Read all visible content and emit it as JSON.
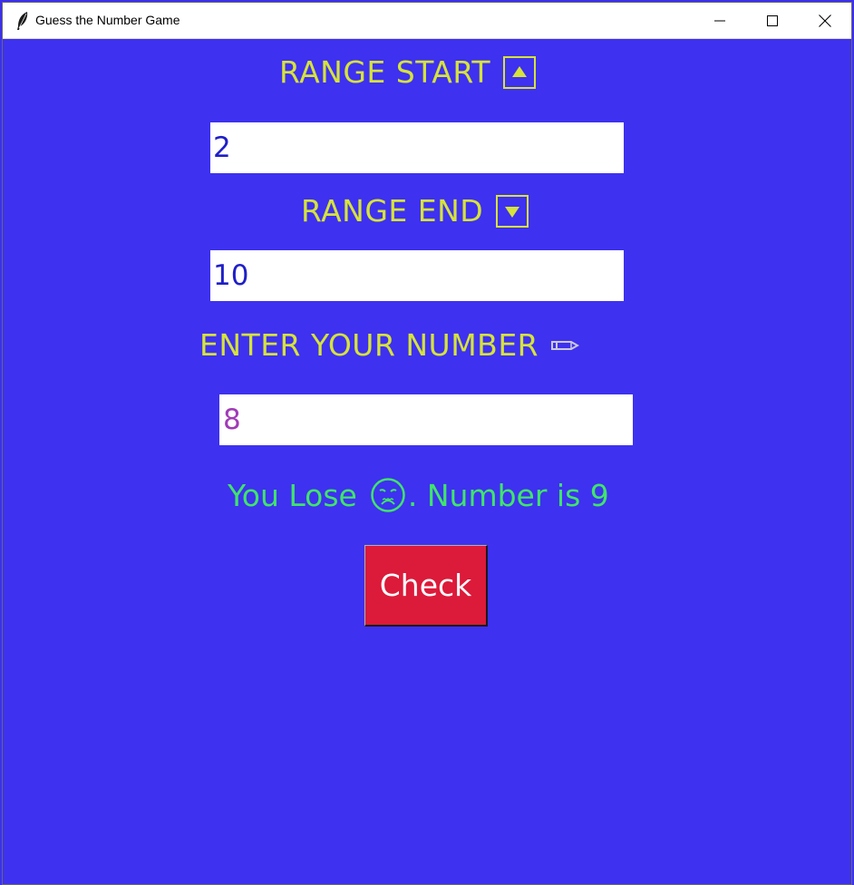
{
  "window": {
    "title": "Guess the Number Game",
    "app_icon": "feather-icon",
    "controls": [
      "minimize-icon",
      "maximize-icon",
      "close-icon"
    ]
  },
  "range_start": {
    "label": "RANGE START",
    "icon": "up-arrow-icon",
    "value": "2"
  },
  "range_end": {
    "label": "RANGE END",
    "icon": "down-arrow-icon",
    "value": "10"
  },
  "guess": {
    "label": "ENTER YOUR NUMBER",
    "icon": "pencil-icon",
    "value": "8"
  },
  "result": {
    "prefix": "You Lose",
    "icon": "sad-face-icon",
    "suffix": ". Number is 9"
  },
  "check_button": {
    "label": "Check"
  },
  "colors": {
    "background": "#3e31f0",
    "label": "#d6e33a",
    "input_text": "#1f1fc8",
    "guess_text": "#a03ab8",
    "result_text": "#3fe56a",
    "button_bg": "#dc1a3a",
    "button_text": "#ffffff"
  }
}
